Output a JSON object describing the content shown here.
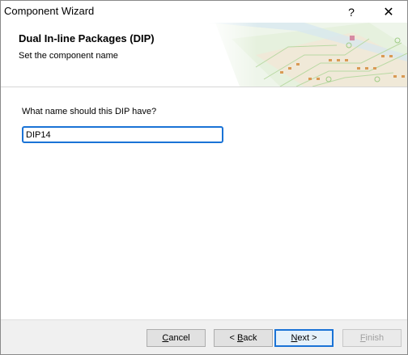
{
  "window": {
    "title": "Component Wizard",
    "help": "?",
    "close": "✕"
  },
  "header": {
    "title": "Dual In-line Packages (DIP)",
    "subtitle": "Set the component name"
  },
  "form": {
    "question": "What name should this DIP have?",
    "name_value": "DIP14"
  },
  "buttons": {
    "cancel": {
      "hotkey": "C",
      "rest": "ancel"
    },
    "back": {
      "pre": "< ",
      "hotkey": "B",
      "rest": "ack"
    },
    "next": {
      "hotkey": "N",
      "rest": "ext >"
    },
    "finish": {
      "hotkey": "F",
      "rest": "inish",
      "disabled": true
    }
  },
  "colors": {
    "focus": "#1a73d6",
    "pcb_green": "#a7d48c",
    "pcb_copper": "#d99a55"
  }
}
